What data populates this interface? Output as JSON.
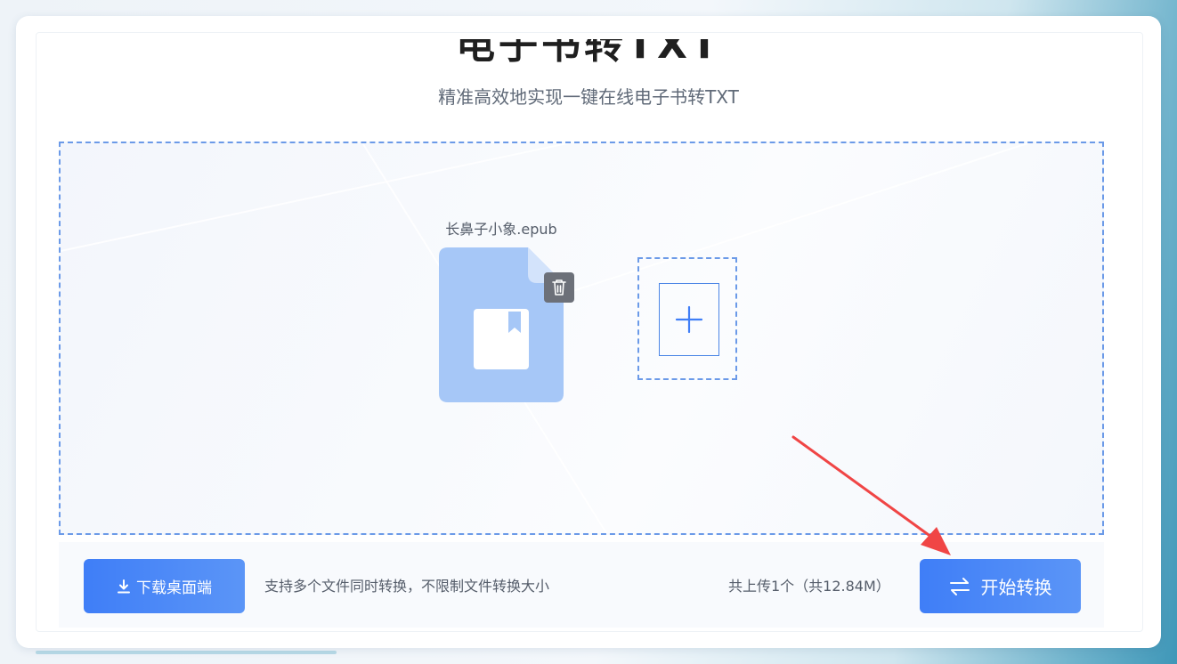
{
  "page": {
    "title": "电子书转TXT",
    "subtitle": "精准高效地实现一键在线电子书转TXT"
  },
  "upload": {
    "files": [
      {
        "name": "长鼻子小象.epub",
        "icon": "epub-file-icon"
      }
    ],
    "delete_icon": "trash-icon",
    "add_icon": "plus-icon"
  },
  "footer": {
    "download_label": "下载桌面端",
    "download_icon": "download-icon",
    "support_text": "支持多个文件同时转换，不限制文件转换大小",
    "count_text": "共上传1个（共12.84M）",
    "start_label": "开始转换",
    "start_icon": "swap-arrows-icon"
  },
  "colors": {
    "primary": "#3f7ef7",
    "dashed_border": "#6b9ae8",
    "file_icon": "#a6c7f7",
    "annotation_arrow": "#f04545"
  }
}
